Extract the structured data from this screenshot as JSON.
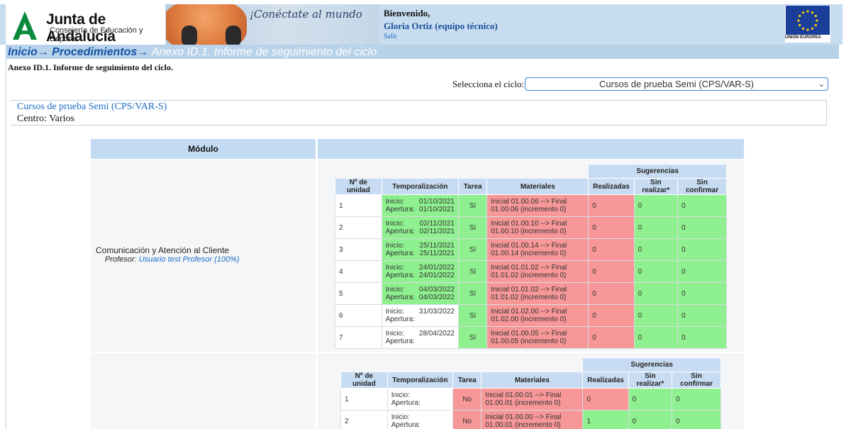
{
  "header": {
    "logo_title": "Junta de Andalucía",
    "logo_subtitle": "Consejería de Educación y Deporte",
    "slogan": "¡Conéctate al mundo",
    "welcome": "Bienvenido,",
    "user": "Gloria Ortiz (equipo técnico)",
    "logout": "Salir",
    "eu_label": "UNIÓN EUROPEA"
  },
  "breadcrumb": {
    "home": "Inicio",
    "sep": "→",
    "procedures": "Procedimientos",
    "current": "Anexo ID.1. Informe de seguimiento del ciclo"
  },
  "page": {
    "title": "Anexo ID.1. Informe de seguimiento del ciclo.",
    "cycle_label": "Selecciona el ciclo:",
    "cycle_value": "Cursos de prueba Semi (CPS/VAR-S)",
    "info_course": "Cursos de prueba Semi (CPS/VAR-S)",
    "info_center": "Centro: Varios"
  },
  "table": {
    "col_module": "Módulo",
    "headers": {
      "unit": "Nº de unidad",
      "timing": "Temporalización",
      "task": "Tarea",
      "materials": "Materiales",
      "suggestions": "Sugerencias",
      "done": "Realizadas",
      "not_done": "Sin realizar*",
      "unconfirmed": "Sin confirmar"
    },
    "labels": {
      "start": "Inicio:",
      "opening": "Apertura:"
    },
    "modules": [
      {
        "name": "Comunicación y Atención al Cliente",
        "teacher_label": "Profesor:",
        "teacher": "Usuario test Profesor (100%)",
        "units": [
          {
            "n": "1",
            "start": "01/10/2021",
            "opening": "01/10/2021",
            "task": "Sí",
            "materials": "Inicial 01.00.06 --> Final 01.00.06 (incremento 0)",
            "done": "0",
            "not_done": "0",
            "unconfirmed": "0"
          },
          {
            "n": "2",
            "start": "02/11/2021",
            "opening": "02/11/2021",
            "task": "Sí",
            "materials": "Inicial 01.00.10 --> Final 01.00.10 (incremento 0)",
            "done": "0",
            "not_done": "0",
            "unconfirmed": "0"
          },
          {
            "n": "3",
            "start": "25/11/2021",
            "opening": "25/11/2021",
            "task": "Sí",
            "materials": "Inicial 01.00.14 --> Final 01.00.14 (incremento 0)",
            "done": "0",
            "not_done": "0",
            "unconfirmed": "0"
          },
          {
            "n": "4",
            "start": "24/01/2022",
            "opening": "24/01/2022",
            "task": "Sí",
            "materials": "Inicial 01.01.02 --> Final 01.01.02 (incremento 0)",
            "done": "0",
            "not_done": "0",
            "unconfirmed": "0"
          },
          {
            "n": "5",
            "start": "04/03/2022",
            "opening": "04/03/2022",
            "task": "Sí",
            "materials": "Inicial 01.01.02 --> Final 01.01.02 (incremento 0)",
            "done": "0",
            "not_done": "0",
            "unconfirmed": "0"
          },
          {
            "n": "6",
            "start": "31/03/2022",
            "opening": "",
            "task": "Sí",
            "materials": "Inicial 01.02.00 --> Final 01.02.00 (incremento 0)",
            "done": "0",
            "not_done": "0",
            "unconfirmed": "0"
          },
          {
            "n": "7",
            "start": "28/04/2022",
            "opening": "",
            "task": "Sí",
            "materials": "Inicial 01.00.05 --> Final 01.00.05 (incremento 0)",
            "done": "0",
            "not_done": "0",
            "unconfirmed": "0"
          }
        ]
      },
      {
        "name": "",
        "units": [
          {
            "n": "1",
            "start": "",
            "opening": "",
            "task": "No",
            "materials": "Inicial 01.00.01 --> Final 01.00.01 (incremento 0)",
            "done": "0",
            "not_done": "0",
            "unconfirmed": "0"
          },
          {
            "n": "2",
            "start": "",
            "opening": "",
            "task": "No",
            "materials": "Inicial 01.00.00 --> Final 01.00.01 (incremento 0)",
            "done": "1",
            "not_done": "0",
            "unconfirmed": "0"
          }
        ]
      }
    ]
  },
  "colors": {
    "header_bg": "#c7dcef",
    "green": "#8ef08e",
    "red": "#f79797",
    "link": "#1b6cc4"
  }
}
